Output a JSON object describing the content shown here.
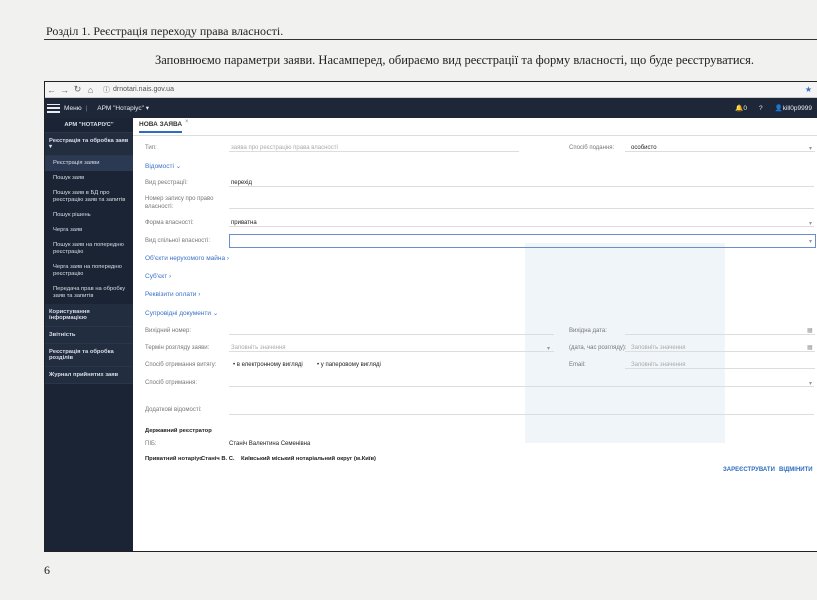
{
  "document": {
    "header": "Розділ 1. Реєстрація переходу права власності.",
    "intro": "Заповнюємо параметри заяви. Насамперед, обираємо вид реєстрації та форму власності, що буде реєструватися.",
    "page_number": "6"
  },
  "browser": {
    "url": "drnotari.nais.gov.ua"
  },
  "app": {
    "menu_label": "Меню",
    "arm_label": "АРМ \"Нотаріус\"",
    "notifications": "0",
    "user": "kill0p9999"
  },
  "sidebar": {
    "title": "АРМ \"НОТАРІУС\"",
    "section1": "Реєстрація та обробка заяв",
    "items": [
      "Реєстрація заяви",
      "Пошук заяв",
      "Пошук заяв в БД про реєстрацію заяв та запитів",
      "Пошук рішень",
      "Черга заяв",
      "Пошук заяв на попередню реєстрацію",
      "Черга заяв на попередню реєстрацію",
      "Передача прав на обробку заяв та запитів"
    ],
    "section2": "Користування інформацією",
    "section3": "Звітність",
    "section4": "Реєстрація та обробка розділів",
    "section5": "Журнал прийнятих заяв"
  },
  "tab": {
    "label": "НОВА ЗАЯВА"
  },
  "form": {
    "type_label": "Тип:",
    "type_value": "заява про реєстрацію права власності",
    "submission_label": "Спосіб подання:",
    "submission_value": "особисто",
    "info_section": "Відомості",
    "registration_kind_label": "Вид реєстрації:",
    "registration_kind_value": "перехід",
    "record_number_label": "Номер запису про право власності:",
    "ownership_form_label": "Форма власності:",
    "ownership_form_value": "приватна",
    "joint_ownership_label": "Вид спільної власності:",
    "objects_section": "Об'єкти нерухомого майна",
    "subject_section": "Суб'єкт",
    "payment_section": "Реквізити оплати",
    "documents_section": "Супровідні документи",
    "outgoing_number_label": "Вихідний номер:",
    "outgoing_date_label": "Вихідна дата:",
    "review_term_label": "Термін розгляду заяви:",
    "review_term_placeholder": "Заповніть значення",
    "review_date_label": "(дата, час розгляду):",
    "review_date_placeholder": "Заповніть значення",
    "receipt_method_label": "Спосіб отримання витягу:",
    "receipt_option1": "в електронному вигляді",
    "receipt_option2": "у паперовому вигляді",
    "email_label": "Email:",
    "email_placeholder": "Заповніть значення",
    "receiving_method_label": "Спосіб отримання:",
    "additional_info_label": "Додаткові відомості:",
    "registrar_section": "Державний реєстратор",
    "pib_label": "ПІБ:",
    "pib_value": "Станіч Валентина Семенівна",
    "notary_label": "Приватний нотаріус",
    "notary_name": "Станіч В. С.",
    "notary_district": "Київський міський нотаріальний округ (м.Київ)"
  },
  "actions": {
    "register": "ЗАРЕЄСТРУВАТИ",
    "cancel": "ВІДМІНИТИ"
  }
}
